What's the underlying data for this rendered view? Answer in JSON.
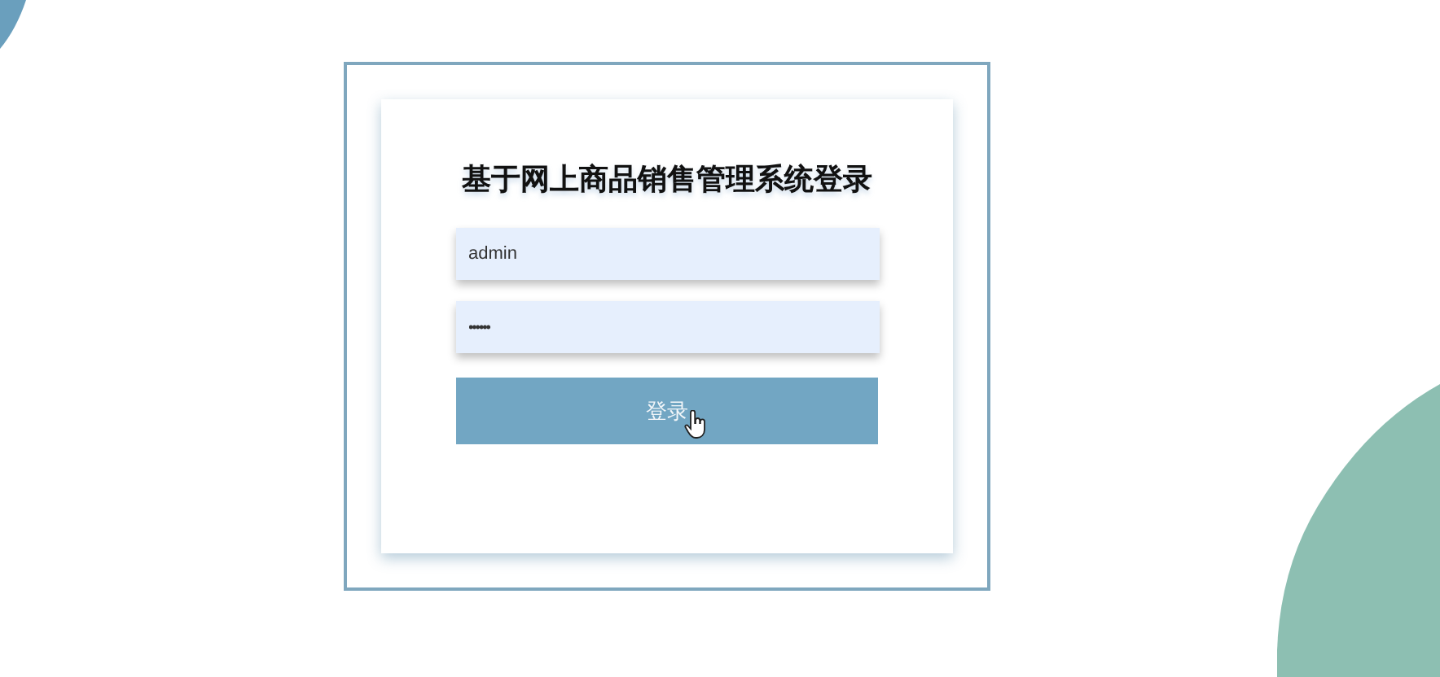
{
  "login": {
    "title": "基于网上商品销售管理系统登录",
    "fields": [
      {
        "kind": "text",
        "value": "admin"
      },
      {
        "kind": "password",
        "value": "••••••"
      }
    ],
    "button": "登录"
  }
}
